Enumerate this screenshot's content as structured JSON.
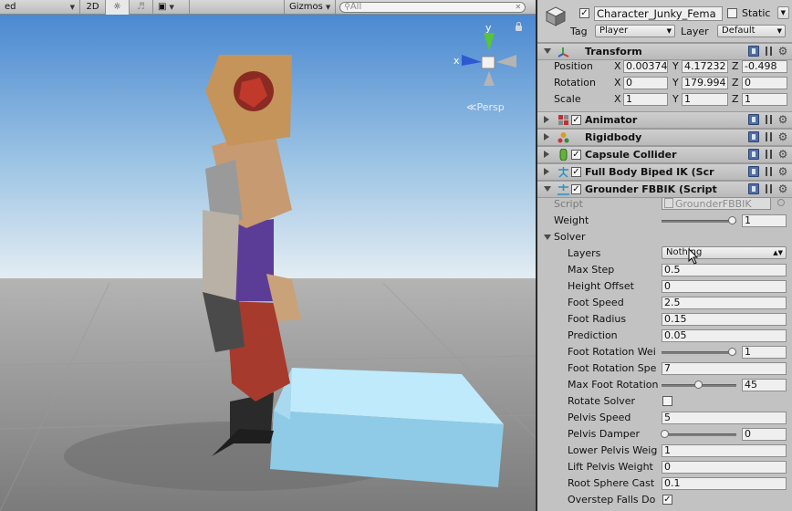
{
  "scene_toolbar": {
    "shading_mode_partial": "ed",
    "mode_2d": "2D",
    "gizmos_label": "Gizmos",
    "search_placeholder": "All",
    "view_label": "Persp"
  },
  "gizmo_axes": {
    "y": "y",
    "x": "x"
  },
  "colors": {
    "inspector_bg": "#c2c2c2",
    "header_bg": "#bdbdbd",
    "sky_top": "#4b89d1",
    "ground": "#8d8d8d",
    "box": "#a6dcf2"
  },
  "inspector": {
    "object": {
      "name": "Character_Junky_Fema",
      "static_label": "Static",
      "tag_label": "Tag",
      "tag_value": "Player",
      "layer_label": "Layer",
      "layer_value": "Default"
    },
    "transform": {
      "title": "Transform",
      "position_label": "Position",
      "position": {
        "x": "0.00374",
        "y": "4.17232",
        "z": "-0.498"
      },
      "rotation_label": "Rotation",
      "rotation": {
        "x": "0",
        "y": "179.994",
        "z": "0"
      },
      "scale_label": "Scale",
      "scale": {
        "x": "1",
        "y": "1",
        "z": "1"
      },
      "axis_x": "X",
      "axis_y": "Y",
      "axis_z": "Z"
    },
    "components": [
      {
        "name": "Animator",
        "enabled": true,
        "icon": "animator-icon"
      },
      {
        "name": "Rigidbody",
        "enabled": null,
        "icon": "rigidbody-icon"
      },
      {
        "name": "Capsule Collider",
        "enabled": true,
        "icon": "capsule-collider-icon"
      },
      {
        "name": "Full Body Biped IK (Scr",
        "enabled": true,
        "icon": "ik-icon"
      }
    ],
    "grounder": {
      "title": "Grounder FBBIK (Script",
      "script_label": "Script",
      "script_value": "GrounderFBBIK",
      "weight_label": "Weight",
      "weight_value": "1",
      "solver_label": "Solver",
      "layers_label": "Layers",
      "layers_value": "Nothing",
      "max_step_label": "Max Step",
      "max_step": "0.5",
      "height_offset_label": "Height Offset",
      "height_offset": "0",
      "foot_speed_label": "Foot Speed",
      "foot_speed": "2.5",
      "foot_radius_label": "Foot Radius",
      "foot_radius": "0.15",
      "prediction_label": "Prediction",
      "prediction": "0.05",
      "foot_rotation_weight_label": "Foot Rotation Wei",
      "foot_rotation_weight": "1",
      "foot_rotation_speed_label": "Foot Rotation Spe",
      "foot_rotation_speed": "7",
      "max_foot_rotation_label": "Max Foot Rotation",
      "max_foot_rotation": "45",
      "rotate_solver_label": "Rotate Solver",
      "rotate_solver": false,
      "pelvis_speed_label": "Pelvis Speed",
      "pelvis_speed": "5",
      "pelvis_damper_label": "Pelvis Damper",
      "pelvis_damper": "0",
      "lower_pelvis_weight_label": "Lower Pelvis Weig",
      "lower_pelvis_weight": "1",
      "lift_pelvis_weight_label": "Lift Pelvis Weight",
      "lift_pelvis_weight": "0",
      "root_sphere_cast_label": "Root Sphere Cast",
      "root_sphere_cast": "0.1",
      "overstep_falls_down_label": "Overstep Falls Do",
      "overstep_falls_down": true
    }
  }
}
